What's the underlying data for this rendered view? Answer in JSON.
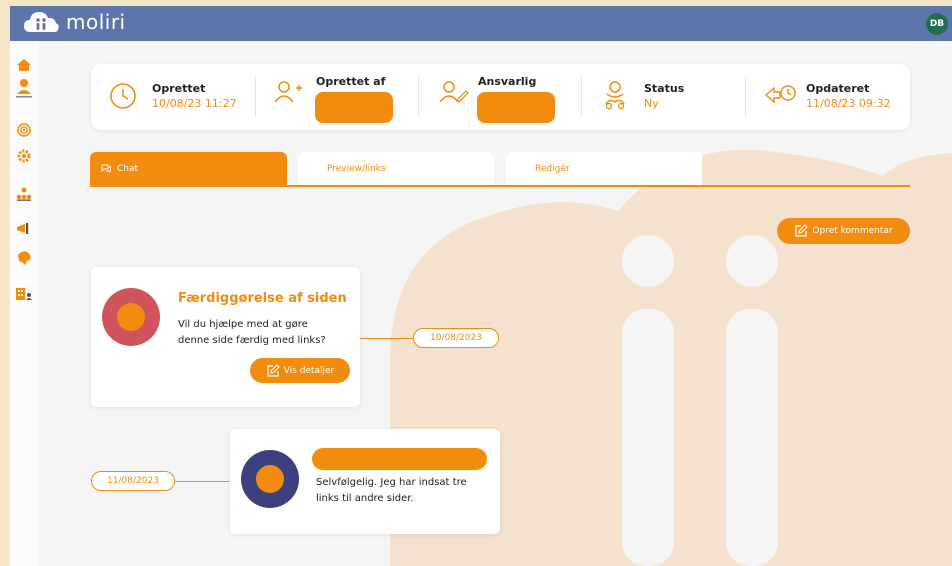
{
  "app": {
    "name": "moliri",
    "user_initials": "DB"
  },
  "sidebar": {
    "items": [
      {
        "name": "home-icon"
      },
      {
        "name": "user-icon"
      },
      {
        "name": "target-icon"
      },
      {
        "name": "settings-icon"
      },
      {
        "name": "org-chart-icon"
      },
      {
        "name": "megaphone-icon"
      },
      {
        "name": "brain-icon"
      },
      {
        "name": "building-user-icon"
      }
    ]
  },
  "info": {
    "created_label": "Oprettet",
    "created_value": "10/08/23 11:27",
    "created_by_label": "Oprettet af",
    "responsible_label": "Ansvarlig",
    "status_label": "Status",
    "status_value": "Ny",
    "updated_label": "Opdateret",
    "updated_value": "11/08/23 09:32"
  },
  "tabs": [
    {
      "label": "Chat",
      "active": true
    },
    {
      "label": "Preview/links",
      "active": false
    },
    {
      "label": "Redigér",
      "active": false
    }
  ],
  "actions": {
    "create_comment": "Opret kommentar"
  },
  "messages": [
    {
      "title": "Færdiggørelse af siden",
      "body_line1": "Vil du hjælpe med at gøre",
      "body_line2": "denne side færdig med links?",
      "button": "Vis detaljer",
      "date": "10/08/2023",
      "avatar_color": "#d0545c"
    },
    {
      "body_line1": "Selvfølgelig. Jeg har indsat tre",
      "body_line2": "links til andre sider.",
      "date": "11/08/2023",
      "avatar_color": "#3e3f7e"
    }
  ],
  "colors": {
    "accent": "#f28c0f",
    "topbar": "#5d75a8",
    "frame": "#f6e6c8"
  }
}
